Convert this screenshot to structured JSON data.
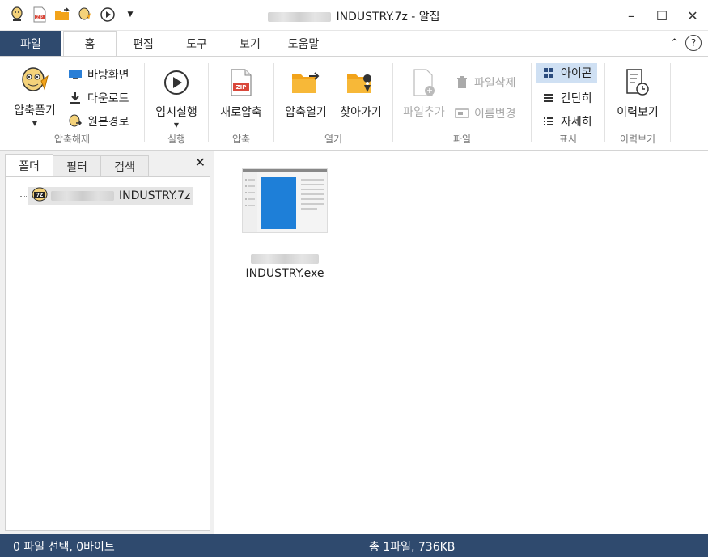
{
  "window": {
    "title": "INDUSTRY.7z - 알집",
    "minimize": "–",
    "maximize": "☐",
    "close": "✕"
  },
  "quick_access": [
    "alzip-icon",
    "zip-icon",
    "open-folder-icon",
    "extract-icon",
    "play-icon",
    "dropdown-icon"
  ],
  "tabs": {
    "file": "파일",
    "items": [
      "홈",
      "편집",
      "도구",
      "보기",
      "도움말"
    ],
    "active": "홈",
    "collapse": "^",
    "help": "?"
  },
  "ribbon": {
    "extract": {
      "big": "압축풀기",
      "desktop": "바탕화면",
      "download": "다운로드",
      "original": "원본경로",
      "group": "압축해제"
    },
    "run": {
      "big": "임시실행",
      "group": "실행"
    },
    "compress": {
      "big": "새로압축",
      "group": "압축"
    },
    "open": {
      "open_archive": "압축열기",
      "find": "찾아가기",
      "group": "열기"
    },
    "file": {
      "add": "파일추가",
      "delete": "파일삭제",
      "rename": "이름변경",
      "group": "파일"
    },
    "view": {
      "icon": "아이콘",
      "simple": "간단히",
      "detail": "자세히",
      "group": "표시"
    },
    "history": {
      "big": "이력보기",
      "group": "이력보기"
    }
  },
  "left_panel": {
    "tabs": [
      "폴더",
      "필터",
      "검색"
    ],
    "close": "✕",
    "tree_item": "INDUSTRY.7z"
  },
  "main": {
    "files": [
      {
        "name": "INDUSTRY.exe"
      }
    ]
  },
  "status": {
    "left": "0 파일 선택,  0바이트",
    "center": "총 1파일,  736KB"
  },
  "colors": {
    "status_bar": "#2f4a6e",
    "file_tab": "#2f4a6e",
    "selected_view": "#cfe0f3",
    "zip_red": "#d9473a",
    "folder_orange": "#f2a31a"
  }
}
